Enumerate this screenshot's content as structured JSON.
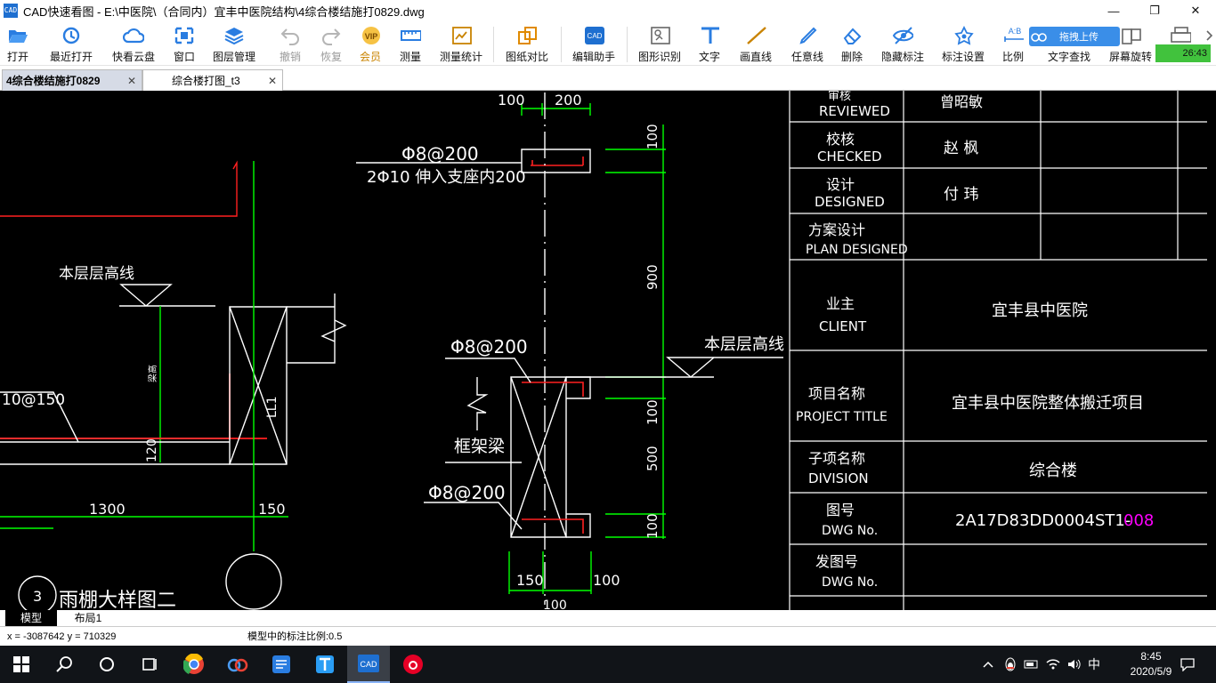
{
  "window": {
    "app_icon_text": "CAD",
    "title": "CAD快速看图 - E:\\中医院\\（合同内）宜丰中医院结构\\4综合楼结施打0829.dwg",
    "minimize": "—",
    "maximize": "❐",
    "close": "✕"
  },
  "toolbar": {
    "buttons": [
      {
        "label": "打开",
        "icon": "folder-open-icon"
      },
      {
        "label": "最近打开",
        "icon": "recent-clock-icon"
      },
      {
        "label": "快看云盘",
        "icon": "cloud-icon"
      },
      {
        "label": "窗口",
        "icon": "window-icon"
      },
      {
        "label": "图层管理",
        "icon": "layers-icon"
      },
      {
        "label": "撤销",
        "icon": "undo-icon"
      },
      {
        "label": "恢复",
        "icon": "redo-icon"
      },
      {
        "label": "会员",
        "icon": "vip-icon"
      },
      {
        "label": "测量",
        "icon": "ruler-icon"
      },
      {
        "label": "测量统计",
        "icon": "measure-stats-icon"
      },
      {
        "label": "图纸对比",
        "icon": "compare-icon"
      },
      {
        "label": "编辑助手",
        "icon": "edit-assistant-icon"
      },
      {
        "label": "图形识别",
        "icon": "shape-recognize-icon"
      },
      {
        "label": "文字",
        "icon": "text-icon"
      },
      {
        "label": "画直线",
        "icon": "line-icon"
      },
      {
        "label": "任意线",
        "icon": "freehand-pen-icon"
      },
      {
        "label": "删除",
        "icon": "eraser-icon"
      },
      {
        "label": "隐藏标注",
        "icon": "hide-eye-icon"
      },
      {
        "label": "标注设置",
        "icon": "annotation-settings-icon"
      },
      {
        "label": "比例",
        "icon": "scale-icon"
      },
      {
        "label": "文字查找",
        "icon": "text-search-icon"
      },
      {
        "label": "屏幕旋转",
        "icon": "screen-rotate-icon"
      }
    ],
    "upload_label": "拖拽上传",
    "timer": "26:43"
  },
  "tabs": [
    {
      "label": "4综合楼结施打0829",
      "close": "✕"
    },
    {
      "label": "综合楼打图_t3",
      "close": "✕"
    }
  ],
  "drawing": {
    "left_detail": {
      "level_line": "本层层高线",
      "rebar_label": "10@150",
      "dim_1300": "1300",
      "dim_150": "150",
      "dim_120": "120",
      "vertical_small": "梁高",
      "beam_label": "LL1",
      "detail_number": "3",
      "detail_title": "雨棚大样图二"
    },
    "center_detail": {
      "dim_top_100": "100",
      "dim_top_200": "200",
      "rebar_top": "Φ8@200",
      "rebar_anchor": "2Φ10  伸入支座内200",
      "dim_v_100a": "100",
      "dim_v_900": "900",
      "level_line": "本层层高线",
      "rebar_mid": "Φ8@200",
      "dim_v_100b": "100",
      "frame_beam": "框架梁",
      "dim_v_500": "500",
      "rebar_bottom": "Φ8@200",
      "dim_v_100c": "100",
      "dim_b_150": "150",
      "dim_b_100": "100",
      "dim_b_100c": "100"
    },
    "title_block": {
      "reviewed_cn": "审核",
      "reviewed_en": "REVIEWED",
      "reviewed_name": "曾昭敏",
      "checked_cn": "校核",
      "checked_en": "CHECKED",
      "checked_name": "赵 枫",
      "designed_cn": "设计",
      "designed_en": "DESIGNED",
      "designed_name": "付 玮",
      "plan_cn": "方案设计",
      "plan_en": "PLAN DESIGNED",
      "client_cn": "业主",
      "client_en": "CLIENT",
      "client_value": "宜丰县中医院",
      "project_cn": "项目名称",
      "project_en": "PROJECT TITLE",
      "project_value": "宜丰县中医院整体搬迁项目",
      "division_cn": "子项名称",
      "division_en": "DIVISION",
      "division_value": "综合楼",
      "dwg_cn": "图号",
      "dwg_en": "DWG No.",
      "dwg_value": "2A17D83DD0004ST1-",
      "dwg_suffix": "008",
      "issue_cn": "发图号",
      "issue_en": "DWG No."
    }
  },
  "layout_tabs": [
    "模型",
    "布局1"
  ],
  "status": {
    "coords": "x = -3087642  y = 710329",
    "scale_text": "模型中的标注比例:0.5"
  },
  "taskbar": {
    "apps": [
      "start-icon",
      "search-icon",
      "cortana-icon",
      "task-view-icon",
      "chrome-icon",
      "baidu-netdisk-icon",
      "cad-reader-icon",
      "text-app-icon",
      "cad-quickview-icon",
      "netease-music-icon"
    ],
    "ime": "中",
    "time": "8:45",
    "date": "2020/5/9"
  },
  "colors": {
    "cad_green": "#00ff00",
    "cad_white": "#ffffff",
    "cad_red": "#ff2020",
    "cad_magenta": "#ff00ff",
    "ribbon_blue": "#1e6fd0",
    "timer_green": "#41c23d"
  }
}
